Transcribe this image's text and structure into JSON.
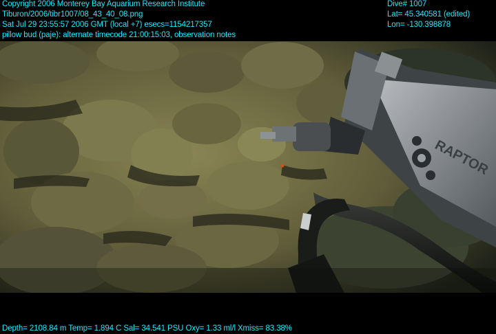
{
  "overlay": {
    "top_left": [
      "Copyright 2006 Monterey Bay Aquarium Research Institute",
      "Tiburon/2006/tibr1007/08_43_40_08.png",
      "Sat Jul 29 23:55:57 2006 GMT (local +7)  esecs=1154217357",
      "pillow bud (paje): alternate timecode 21:00:15:03, observation notes"
    ],
    "top_right": [
      "Dive# 1007",
      "Lat= 45.340581 (edited)",
      "Lon= -130.398878"
    ],
    "bottom": "Depth= 2108.84 m  Temp= 1.894 C  Sal= 34.541 PSU  Oxy= 1.33 ml/l  Xmiss= 83.38%"
  },
  "scene": {
    "arm_label": "RAPTOR",
    "colors": {
      "seafloor": "#6e6a43",
      "rock": "#7b7a4d",
      "rock_shadow": "#2d2d1f",
      "overlay_text": "#1ee8ff"
    }
  }
}
